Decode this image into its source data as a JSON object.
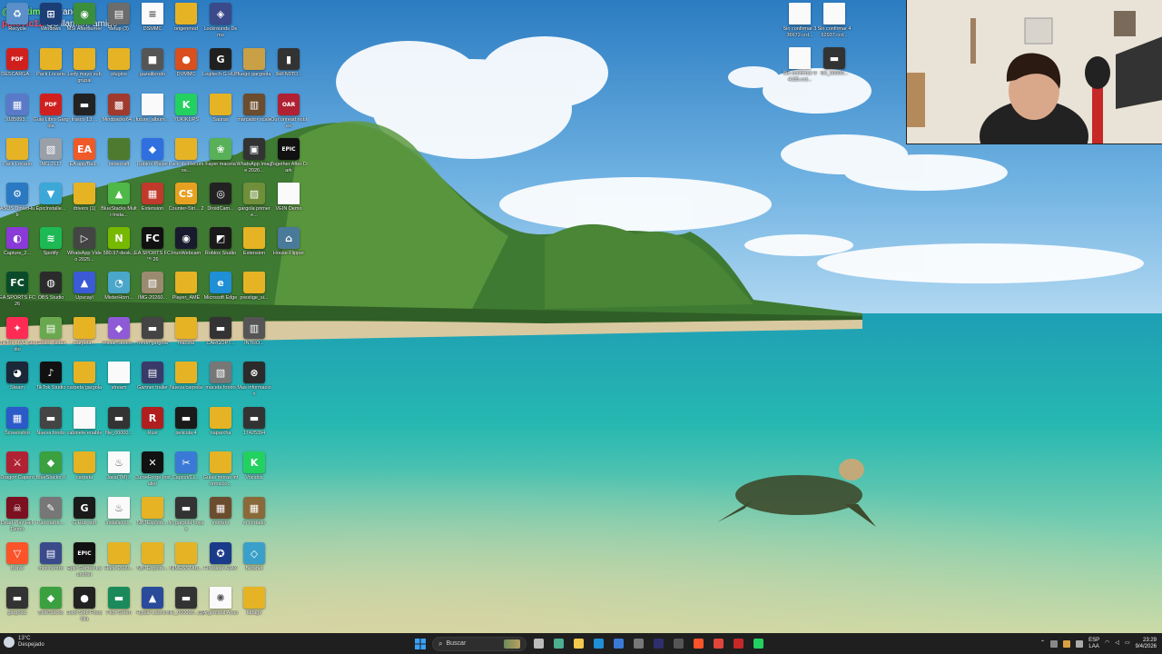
{
  "overlay": {
    "line1_prefix": "@gustimarq",
    "line1_suffix": " tranqui",
    "line2_user": "patovic12",
    "line2_text": " Q3 llamen, amigo"
  },
  "desktop_icons": [
    {
      "label": "Recycle",
      "color": "#5a8fc9",
      "type": "app",
      "glyph": "♻"
    },
    {
      "label": "Windows",
      "color": "#1c3e77",
      "type": "app",
      "glyph": "⊞"
    },
    {
      "label": "MSI Afterburner",
      "color": "#3b8e3b",
      "type": "app",
      "glyph": "◉"
    },
    {
      "label": "setup (3)",
      "color": "#6c6c6c",
      "type": "app",
      "glyph": "▤"
    },
    {
      "label": "DSMMC",
      "color": "#ffffff",
      "type": "doc",
      "glyph": "≡"
    },
    {
      "label": "origenmod",
      "color": "#e6b325",
      "type": "folder",
      "glyph": ""
    },
    {
      "label": "Lockrounds Demo",
      "color": "#3a4a8a",
      "type": "app",
      "glyph": "◈"
    },
    {
      "label": "DESCARGA...",
      "color": "#d0201e",
      "type": "app",
      "glyph": "PDF"
    },
    {
      "label": "Pack Locario",
      "color": "#e6b325",
      "type": "folder",
      "glyph": ""
    },
    {
      "label": "Ledy mayo subgrupal",
      "color": "#e6b325",
      "type": "folder",
      "glyph": ""
    },
    {
      "label": "plugins",
      "color": "#e6b325",
      "type": "folder",
      "glyph": ""
    },
    {
      "label": "gazalibrodo",
      "color": "#555555",
      "type": "app",
      "glyph": "■"
    },
    {
      "label": "DVMMC",
      "color": "#d9501e",
      "type": "app",
      "glyph": "●"
    },
    {
      "label": "Logitech G HUB",
      "color": "#202020",
      "type": "app",
      "glyph": "G"
    },
    {
      "label": "fuego gargoola",
      "color": "#c9a046",
      "type": "folder",
      "glyph": ""
    },
    {
      "label": "9HFN9TD...",
      "color": "#333333",
      "type": "app",
      "glyph": "▮"
    },
    {
      "label": "9185893...",
      "color": "#5a7ac9",
      "type": "app",
      "glyph": "▦"
    },
    {
      "label": "Guia Libro Gargola",
      "color": "#d0201e",
      "type": "app",
      "glyph": "PDF"
    },
    {
      "label": "frasco 13 ...",
      "color": "#222222",
      "type": "app",
      "glyph": "▬"
    },
    {
      "label": "Mindpacks64...",
      "color": "#a03a2e",
      "type": "app",
      "glyph": "▩"
    },
    {
      "label": "future_album...",
      "color": "#ffffff",
      "type": "doc",
      "glyph": ""
    },
    {
      "label": "YUKIKUPS",
      "color": "#23d160",
      "type": "app",
      "glyph": "K"
    },
    {
      "label": "Sauras",
      "color": "#e6b325",
      "type": "folder",
      "glyph": ""
    },
    {
      "label": "marcador scale",
      "color": "#6b4c2e",
      "type": "app",
      "glyph": "▥"
    },
    {
      "label": "Our unread nobles",
      "color": "#b02233",
      "type": "app",
      "glyph": "OAR"
    },
    {
      "label": "Pack Locario",
      "color": "#e6b325",
      "type": "folder",
      "glyph": ""
    },
    {
      "label": "IMG 2117",
      "color": "#9aa0a8",
      "type": "app",
      "glyph": "▧"
    },
    {
      "label": "EA app/Ball...",
      "color": "#f05a28",
      "type": "app",
      "glyph": "EA"
    },
    {
      "label": "minecraft",
      "color": "#4d7a2e",
      "type": "folder",
      "glyph": ""
    },
    {
      "label": "Roblox Player",
      "color": "#2f6fe0",
      "type": "app",
      "glyph": "◆"
    },
    {
      "label": "Pack de Recursos...",
      "color": "#e6b325",
      "type": "folder",
      "glyph": ""
    },
    {
      "label": "Fayer maceta",
      "color": "#58b058",
      "type": "app",
      "glyph": "❀"
    },
    {
      "label": "WhatsApp Image 2026...",
      "color": "#333333",
      "type": "app",
      "glyph": "▣"
    },
    {
      "label": "Together After Dark",
      "color": "#111111",
      "type": "app",
      "glyph": "EPIC"
    },
    {
      "label": "ASUS DriverHub",
      "color": "#2b79c2",
      "type": "app",
      "glyph": "⚙"
    },
    {
      "label": "EpicInstalle...",
      "color": "#3ba8d8",
      "type": "app",
      "glyph": "▼"
    },
    {
      "label": "drivers (1)",
      "color": "#e6b325",
      "type": "folder",
      "glyph": ""
    },
    {
      "label": "BlueStacks Multi-Insta...",
      "color": "#4fb848",
      "type": "app",
      "glyph": "▲"
    },
    {
      "label": "Extension",
      "color": "#c0392b",
      "type": "app",
      "glyph": "▦"
    },
    {
      "label": "Counter-Stri... 2",
      "color": "#e8a020",
      "type": "app",
      "glyph": "CS"
    },
    {
      "label": "DroidCam...",
      "color": "#222222",
      "type": "app",
      "glyph": "◎"
    },
    {
      "label": "gargola primer e...",
      "color": "#6f8f3a",
      "type": "app",
      "glyph": "▨"
    },
    {
      "label": "VEIN Demo",
      "color": "#ffffff",
      "type": "doc",
      "glyph": ""
    },
    {
      "label": "Capture_2...",
      "color": "#8a3ad6",
      "type": "app",
      "glyph": "◐"
    },
    {
      "label": "Spotify",
      "color": "#1db954",
      "type": "app",
      "glyph": "≋"
    },
    {
      "label": "WhatsApp Video 2025...",
      "color": "#444444",
      "type": "app",
      "glyph": "▷"
    },
    {
      "label": "580.97-desk...",
      "color": "#76b900",
      "type": "app",
      "glyph": "N"
    },
    {
      "label": "EA SPORTS FC™ 26",
      "color": "#111111",
      "type": "app",
      "glyph": "FC"
    },
    {
      "label": "IriunWebcam",
      "color": "#1a1a2e",
      "type": "app",
      "glyph": "◉"
    },
    {
      "label": "Roblox Studio",
      "color": "#1a1a1a",
      "type": "app",
      "glyph": "◩"
    },
    {
      "label": "Extension",
      "color": "#e6b325",
      "type": "folder",
      "glyph": ""
    },
    {
      "label": "House Flipper",
      "color": "#4a7a9a",
      "type": "app",
      "glyph": "⌂"
    },
    {
      "label": "EA SPORTS FC 26",
      "color": "#0a4c2a",
      "type": "app",
      "glyph": "FC"
    },
    {
      "label": "OBS Studio",
      "color": "#2b2b2b",
      "type": "app",
      "glyph": "◍"
    },
    {
      "label": "Upscayl",
      "color": "#3a5ad6",
      "type": "app",
      "glyph": "▲"
    },
    {
      "label": "MisterHorn...",
      "color": "#4aa7c9",
      "type": "app",
      "glyph": "◔"
    },
    {
      "label": "IMG-20260...",
      "color": "#9a8a70",
      "type": "app",
      "glyph": "▧"
    },
    {
      "label": "Player_AME",
      "color": "#e6b325",
      "type": "folder",
      "glyph": ""
    },
    {
      "label": "Microsoft Edge",
      "color": "#1f8fd6",
      "type": "app",
      "glyph": "e"
    },
    {
      "label": "prestige_si...",
      "color": "#e6b325",
      "type": "folder",
      "glyph": ""
    },
    {
      "label": "TikTok LIVE Studio",
      "color": "#fe2c55",
      "type": "app",
      "glyph": "✦"
    },
    {
      "label": "Gestor Notas",
      "color": "#6aa84f",
      "type": "app",
      "glyph": "▤"
    },
    {
      "label": "Carpeta...",
      "color": "#e6b325",
      "type": "folder",
      "glyph": ""
    },
    {
      "label": "Visual Studio...",
      "color": "#8e5ad6",
      "type": "app",
      "glyph": "◆"
    },
    {
      "label": "fondo gargola",
      "color": "#444444",
      "type": "app",
      "glyph": "▬"
    },
    {
      "label": "maceta",
      "color": "#e6b325",
      "type": "folder",
      "glyph": ""
    },
    {
      "label": "CARGOPT...",
      "color": "#333333",
      "type": "app",
      "glyph": "▬"
    },
    {
      "label": "INTRO...",
      "color": "#555555",
      "type": "app",
      "glyph": "▥"
    },
    {
      "label": "Steam",
      "color": "#1b2838",
      "type": "app",
      "glyph": "◕"
    },
    {
      "label": "TikTok Studio",
      "color": "#111111",
      "type": "app",
      "glyph": "♪"
    },
    {
      "label": "carpeta gargola",
      "color": "#e6b325",
      "type": "folder",
      "glyph": ""
    },
    {
      "label": "stream",
      "color": "#ffffff",
      "type": "doc",
      "glyph": ""
    },
    {
      "label": "Gartner trailer",
      "color": "#3a3a6a",
      "type": "app",
      "glyph": "▤"
    },
    {
      "label": "Nueva carpeta",
      "color": "#e6b325",
      "type": "folder",
      "glyph": ""
    },
    {
      "label": "maceta fondo",
      "color": "#777777",
      "type": "app",
      "glyph": "▧"
    },
    {
      "label": "Mas informacion",
      "color": "#2b2b2b",
      "type": "app",
      "glyph": "⊗"
    },
    {
      "label": "Screenshot",
      "color": "#2b5ac9",
      "type": "app",
      "glyph": "▦"
    },
    {
      "label": "Nueva fondo",
      "color": "#444444",
      "type": "app",
      "glyph": "▬"
    },
    {
      "label": "cabinete enable",
      "color": "#d9d9d9",
      "type": "doc",
      "glyph": ""
    },
    {
      "label": "file_00000...",
      "color": "#333333",
      "type": "app",
      "glyph": "▬"
    },
    {
      "label": "Rust",
      "color": "#b01e1e",
      "type": "app",
      "glyph": "R"
    },
    {
      "label": "pelicula 4",
      "color": "#1a1a1a",
      "type": "app",
      "glyph": "▬"
    },
    {
      "label": "naparcha",
      "color": "#e6b325",
      "type": "folder",
      "glyph": ""
    },
    {
      "label": "17425394",
      "color": "#333333",
      "type": "app",
      "glyph": "▬"
    },
    {
      "label": "Dragon Capers",
      "color": "#b02233",
      "type": "app",
      "glyph": "⚔"
    },
    {
      "label": "BlueStacks X",
      "color": "#3aa040",
      "type": "app",
      "glyph": "◆"
    },
    {
      "label": "carpeta",
      "color": "#e6b325",
      "type": "folder",
      "glyph": ""
    },
    {
      "label": "Java(TM)...",
      "color": "#ffffff",
      "type": "doc",
      "glyph": "♨"
    },
    {
      "label": "CurseForge Installer",
      "color": "#111111",
      "type": "app",
      "glyph": "✕"
    },
    {
      "label": "Capcut/CL...",
      "color": "#3a7ad6",
      "type": "app",
      "glyph": "✂"
    },
    {
      "label": "Guias moras informacio...",
      "color": "#e6b325",
      "type": "folder",
      "glyph": ""
    },
    {
      "label": "Vocidos",
      "color": "#23d160",
      "type": "app",
      "glyph": "K"
    },
    {
      "label": "Dead Play Hell Demo",
      "color": "#7a1020",
      "type": "app",
      "glyph": "☠"
    },
    {
      "label": "Pancita-dc...",
      "color": "#777777",
      "type": "app",
      "glyph": "✎"
    },
    {
      "label": "G Hub soft",
      "color": "#1a1a1a",
      "type": "app",
      "glyph": "G"
    },
    {
      "label": "installer.cl...",
      "color": "#ffffff",
      "type": "doc",
      "glyph": "♨"
    },
    {
      "label": "NBTExplore...",
      "color": "#e6b325",
      "type": "folder",
      "glyph": ""
    },
    {
      "label": "fin gargola hoyas",
      "color": "#333333",
      "type": "app",
      "glyph": "▬"
    },
    {
      "label": "mortero",
      "color": "#6b4c2e",
      "type": "app",
      "glyph": "▦"
    },
    {
      "label": "m.cortado",
      "color": "#8a6a3a",
      "type": "app",
      "glyph": "▦"
    },
    {
      "label": "Brave",
      "color": "#fb542b",
      "type": "app",
      "glyph": "▽"
    },
    {
      "label": "mini-centro",
      "color": "#3a4a8a",
      "type": "app",
      "glyph": "▤"
    },
    {
      "label": "Epic Games Launcher",
      "color": "#111111",
      "type": "app",
      "glyph": "EPIC"
    },
    {
      "label": "Halfe-2600...",
      "color": "#e6b325",
      "type": "folder",
      "glyph": ""
    },
    {
      "label": "NBTExplore...",
      "color": "#e6b325",
      "type": "folder",
      "glyph": ""
    },
    {
      "label": "NIMESSTAB...",
      "color": "#e6b325",
      "type": "folder",
      "glyph": ""
    },
    {
      "label": "Firebase AJAX",
      "color": "#1a3a8a",
      "type": "app",
      "glyph": "✪"
    },
    {
      "label": "Betanet",
      "color": "#3aa0c9",
      "type": "app",
      "glyph": "◇"
    },
    {
      "label": "gargolas",
      "color": "#333333",
      "type": "app",
      "glyph": "▬"
    },
    {
      "label": "BlueStacks",
      "color": "#3aa040",
      "type": "app",
      "glyph": "◆"
    },
    {
      "label": "Dark Soul Fotos Ola",
      "color": "#222222",
      "type": "app",
      "glyph": "●"
    },
    {
      "label": "Pico Green",
      "color": "#1a8a5a",
      "type": "app",
      "glyph": "▬"
    },
    {
      "label": "Hytale Launch",
      "color": "#2a4a9a",
      "type": "app",
      "glyph": "▲"
    },
    {
      "label": "file_000000...(3)",
      "color": "#333333",
      "type": "app",
      "glyph": "▬"
    },
    {
      "label": "Argentinal Anan",
      "color": "#e0e0e0",
      "type": "doc",
      "glyph": "✺"
    },
    {
      "label": "tattage",
      "color": "#e6b325",
      "type": "folder",
      "glyph": ""
    }
  ],
  "right_icons": [
    {
      "label": "Sin confirmar 336672.crd...",
      "color": "#ffffff",
      "type": "doc",
      "glyph": ""
    },
    {
      "label": "Sin confirmar 462937.crd...",
      "color": "#ffffff",
      "type": "doc",
      "glyph": ""
    },
    {
      "label": "Sin confirmar 94185.crd...",
      "color": "#ffffff",
      "type": "doc",
      "glyph": ""
    },
    {
      "label": "file_00000...",
      "color": "#333333",
      "type": "app",
      "glyph": "▬"
    }
  ],
  "taskbar": {
    "weather_temp": "13°C",
    "weather_desc": "Despejado",
    "search_placeholder": "Buscar",
    "apps": [
      {
        "name": "start",
        "color": "#2b9af3"
      },
      {
        "name": "task-view",
        "color": "#bbbbbb"
      },
      {
        "name": "copilot",
        "color": "#4caf8f"
      },
      {
        "name": "file-explorer",
        "color": "#f2c94c"
      },
      {
        "name": "edge",
        "color": "#1f8fd6"
      },
      {
        "name": "store",
        "color": "#3a7ad6"
      },
      {
        "name": "calculator",
        "color": "#777777"
      },
      {
        "name": "app-fe",
        "color": "#2e2e6e"
      },
      {
        "name": "app-mail",
        "color": "#555555"
      },
      {
        "name": "brave",
        "color": "#fb542b"
      },
      {
        "name": "chrome",
        "color": "#e0453a"
      },
      {
        "name": "app-red",
        "color": "#c62828"
      },
      {
        "name": "kick",
        "color": "#23d160"
      }
    ],
    "lang": "ESP",
    "lang_sub": "LAA",
    "time": "23:29",
    "date": "9/4/2026"
  },
  "colors": {
    "sky_top": "#2a7dc4",
    "sky_low": "#8cc3ea",
    "sea": "#27b4b0",
    "sand": "#d9c9a0",
    "taskbar": "#1f1f1f"
  }
}
